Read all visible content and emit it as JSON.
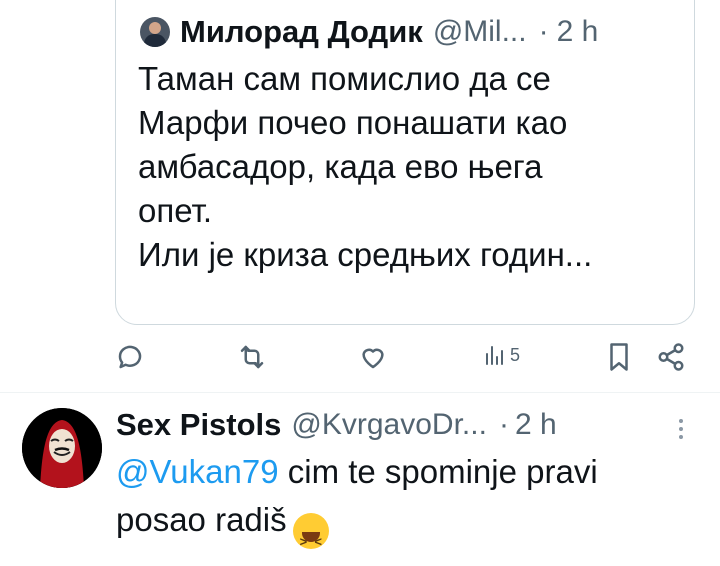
{
  "quoted_tweet": {
    "author_name": "Милорад Додик",
    "handle": "@Mil...",
    "separator": "·",
    "time": "2 h",
    "text_lines": [
      "Таман сам помислио да се",
      "Марфи почео понашати као",
      "амбасадор, када ево њега",
      "опет.",
      "Или је криза средњих годин..."
    ],
    "avatar_icon": "person-avatar"
  },
  "actions": {
    "reply_icon": "reply-icon",
    "retweet_icon": "retweet-icon",
    "like_icon": "heart-icon",
    "views_icon": "views-chart-icon",
    "views_count": "5",
    "bookmark_icon": "bookmark-icon",
    "share_icon": "share-icon"
  },
  "reply": {
    "author_name": "Sex Pistols",
    "handle": "@KvrgavoDr...",
    "separator": "·",
    "time": "2 h",
    "mention": "@Vukan79",
    "text_line1_rest": " cim te spominje pravi",
    "text_line2": "posao radiš",
    "emoji": "😆",
    "more_icon": "more-vertical-icon"
  },
  "colors": {
    "text": "#0f1419",
    "secondary": "#536471",
    "link": "#1d9bf0",
    "border": "#cfd9de"
  }
}
